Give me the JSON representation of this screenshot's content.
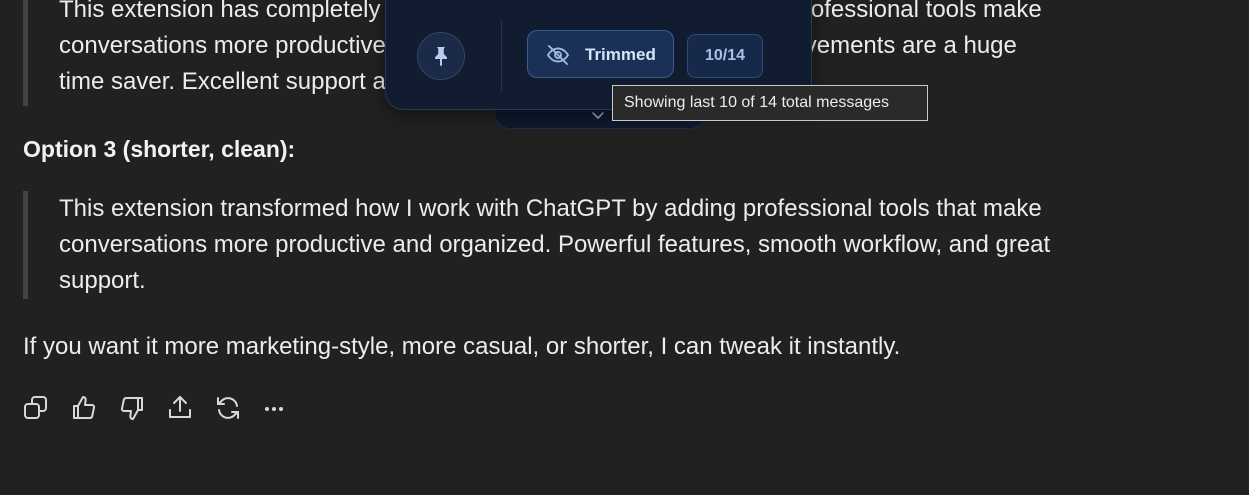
{
  "message": {
    "option2_quote_lines": [
      "This extension has completely transformed how I use ChatGPT. The professional tools make",
      "conversations more productive and organized, and the workflow improvements are a huge",
      "time saver. Excellent support and thoughtful design."
    ],
    "option3_heading": "Option 3 (shorter, clean):",
    "option3_quote_lines": [
      "This extension transformed how I work with ChatGPT by adding professional tools that make",
      "conversations more productive and organized. Powerful features, smooth workflow, and great",
      "support."
    ],
    "outro": "If you want it more marketing-style, more casual, or shorter, I can tweak it instantly."
  },
  "actions": {
    "icons": [
      "copy-icon",
      "thumbs-up-icon",
      "thumbs-down-icon",
      "share-icon",
      "regenerate-icon",
      "more-icon"
    ]
  },
  "trim_panel": {
    "trimmed_label": "Trimmed",
    "count": "10/14",
    "tooltip": "Showing last 10 of 14 total messages",
    "icons": [
      "pin-icon",
      "eye-off-icon",
      "chevron-down-icon"
    ]
  },
  "colors": {
    "background": "#212121",
    "text": "#ececec",
    "panel_bg": "#111c31",
    "accent": "#3a5c93"
  }
}
